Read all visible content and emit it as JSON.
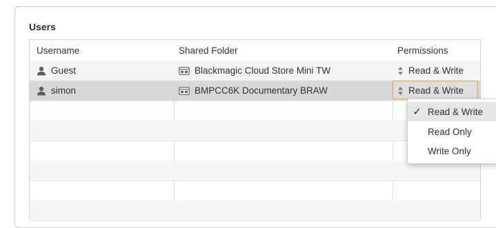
{
  "users_section": {
    "title": "Users",
    "columns": [
      "Username",
      "Shared Folder",
      "Permissions"
    ],
    "rows": [
      {
        "username": "Guest",
        "shared_folder": "Blackmagic Cloud Store Mini TW",
        "permissions": "Read & Write",
        "selected": false
      },
      {
        "username": "simon",
        "shared_folder": "BMPCC6K Documentary BRAW",
        "permissions": "Read & Write",
        "selected": true
      }
    ]
  },
  "permissions_menu": {
    "options": [
      "Read & Write",
      "Read Only",
      "Write Only"
    ],
    "selected_option": "Read & Write",
    "check_glyph": "✓"
  },
  "colors": {
    "focus_border": "#e6a630",
    "selected_row": "#d8d8d8",
    "menu_highlight": "#e6e6e6"
  }
}
